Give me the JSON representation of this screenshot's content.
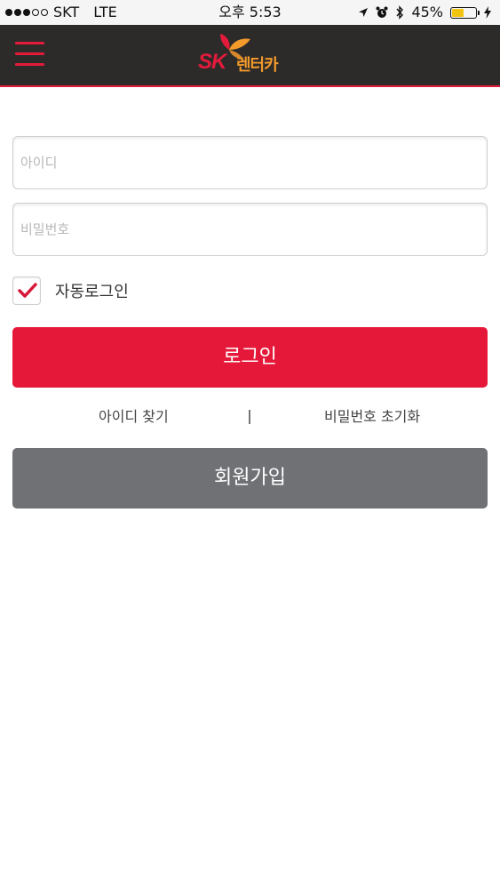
{
  "status_bar": {
    "carrier": "SKT",
    "network": "LTE",
    "time": "오후 5:53",
    "battery": "45%",
    "battery_level": 0.45,
    "icons": [
      "location-arrow-icon",
      "alarm-icon",
      "bluetooth-icon",
      "battery-icon",
      "charging-bolt-icon"
    ]
  },
  "header": {
    "menu_icon": "hamburger-menu-icon",
    "logo": {
      "brand": "SK",
      "name": "렌터카"
    },
    "accent_color": "#e31b3b"
  },
  "login_form": {
    "id_field": {
      "placeholder": "아이디",
      "value": ""
    },
    "password_field": {
      "placeholder": "비밀번호",
      "value": ""
    },
    "auto_login": {
      "label": "자동로그인",
      "checked": true
    },
    "login_button": "로그인",
    "find_id_link": "아이디 찾기",
    "reset_password_link": "비밀번호 초기화",
    "signup_button": "회원가입"
  },
  "colors": {
    "primary_button": "#e5183a",
    "secondary_button": "#6f7174",
    "header_bg": "#2d2b2a",
    "logo_orange": "#f39a2b"
  }
}
